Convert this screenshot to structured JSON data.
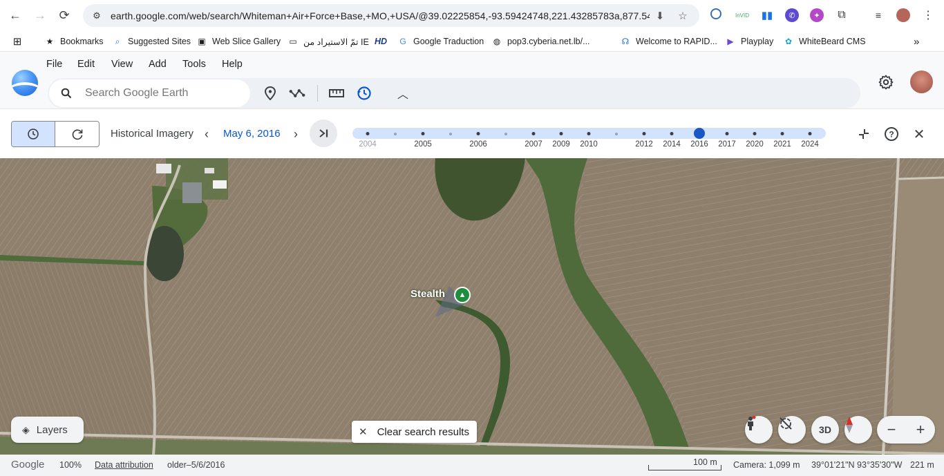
{
  "browser": {
    "url": "earth.google.com/web/search/Whiteman+Air+Force+Base,+MO,+USA/@39.02225854,-93.59424748,221.43285783a,877.54...",
    "bookmarks": [
      {
        "icon": "star-icon",
        "label": "Bookmarks"
      },
      {
        "icon": "search-icon",
        "label": "Suggested Sites"
      },
      {
        "icon": "web-slice-icon",
        "label": "Web Slice Gallery"
      },
      {
        "icon": "folder-icon",
        "label": "تمّ الاستيراد من IE"
      },
      {
        "icon": "hd-icon",
        "label": ""
      },
      {
        "icon": "translate-icon",
        "label": "Google Traduction"
      },
      {
        "icon": "globe-icon",
        "label": "pop3.cyberia.net.lb/..."
      },
      {
        "icon": "rapid-icon",
        "label": "Welcome to RAPID..."
      },
      {
        "icon": "playplay-icon",
        "label": "Playplay"
      },
      {
        "icon": "whitebeard-icon",
        "label": "WhiteBeard CMS"
      }
    ],
    "hd_label": "HD"
  },
  "earth": {
    "menu": [
      "File",
      "Edit",
      "View",
      "Add",
      "Tools",
      "Help"
    ],
    "search_placeholder": "Search Google Earth"
  },
  "historical": {
    "label": "Historical Imagery",
    "date": "May 6, 2016",
    "timeline": [
      {
        "year": "2004",
        "kind": "dim"
      },
      {
        "year": "",
        "kind": "light"
      },
      {
        "year": "2005",
        "kind": "normal"
      },
      {
        "year": "",
        "kind": "light"
      },
      {
        "year": "2006",
        "kind": "normal"
      },
      {
        "year": "",
        "kind": "light"
      },
      {
        "year": "2007",
        "kind": "normal"
      },
      {
        "year": "2009",
        "kind": "normal"
      },
      {
        "year": "2010",
        "kind": "normal"
      },
      {
        "year": "",
        "kind": "light"
      },
      {
        "year": "2012",
        "kind": "normal"
      },
      {
        "year": "2014",
        "kind": "normal"
      },
      {
        "year": "2016",
        "kind": "selected"
      },
      {
        "year": "2017",
        "kind": "normal"
      },
      {
        "year": "2020",
        "kind": "normal"
      },
      {
        "year": "2021",
        "kind": "normal"
      },
      {
        "year": "2024",
        "kind": "normal"
      }
    ]
  },
  "map": {
    "placemark_label": "Stealth",
    "layers_label": "Layers",
    "clear_label": "Clear search results",
    "btn_3d": "3D"
  },
  "status": {
    "brand": "Google",
    "zoom": "100%",
    "attribution": "Data attribution",
    "imagery_date": "older–5/6/2016",
    "scale": "100 m",
    "camera": "Camera: 1,099 m",
    "coords": "39°01'21\"N 93°35'30\"W",
    "elevation": "221 m"
  },
  "colors": {
    "accent": "#0b57d0",
    "timeline_track": "#d3e3fd",
    "marker": "#1e8e3e"
  }
}
